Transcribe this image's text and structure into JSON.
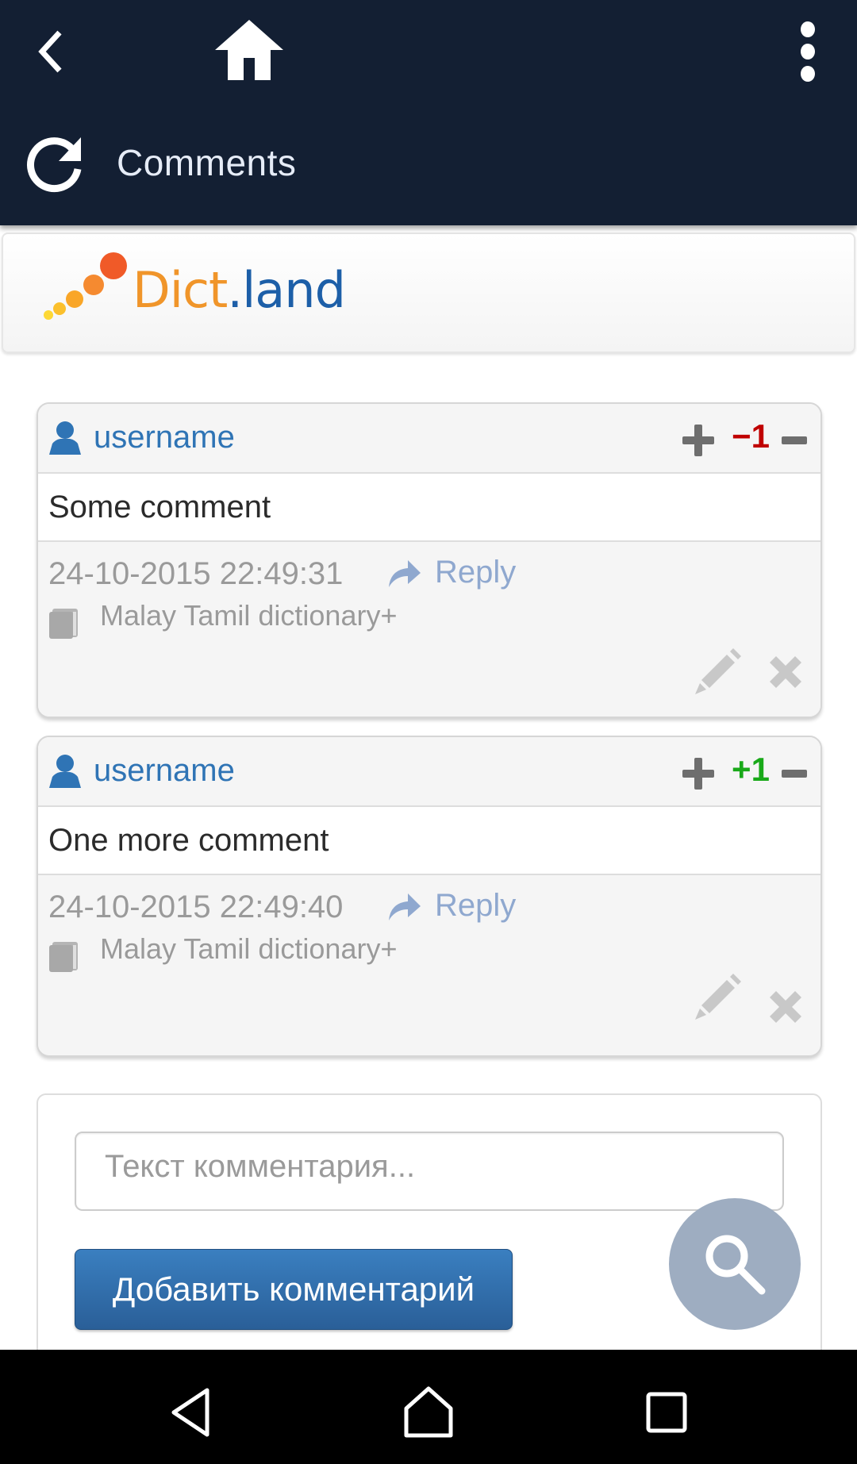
{
  "app_bar": {
    "title": "Comments",
    "back_icon": "chevron-left-icon",
    "home_icon": "home-icon",
    "menu_icon": "more-vertical-icon",
    "refresh_icon": "refresh-icon",
    "background_color": "#131f33"
  },
  "logo": {
    "part1": "Dict",
    "part2": ".land",
    "color1": "#f0952a",
    "color2": "#1d5fa8"
  },
  "comments": [
    {
      "username": "username",
      "score": "−1",
      "score_color": "#c00000",
      "text": "Some comment",
      "date": "24-10-2015 22:49:31",
      "reply_label": "Reply",
      "dictionary": "Malay Tamil dictionary+"
    },
    {
      "username": "username",
      "score": "+1",
      "score_color": "#19a919",
      "text": "One more comment",
      "date": "24-10-2015 22:49:40",
      "reply_label": "Reply",
      "dictionary": "Malay Tamil dictionary+"
    }
  ],
  "form": {
    "input_value": "",
    "input_placeholder": "Текст комментария...",
    "submit_label": "Добавить комментарий"
  },
  "fab": {
    "icon": "search-icon",
    "color": "#9eadc1"
  },
  "nav_bar": {
    "back_icon": "nav-back-icon",
    "home_icon": "nav-home-icon",
    "recent_icon": "nav-recent-apps-icon"
  }
}
